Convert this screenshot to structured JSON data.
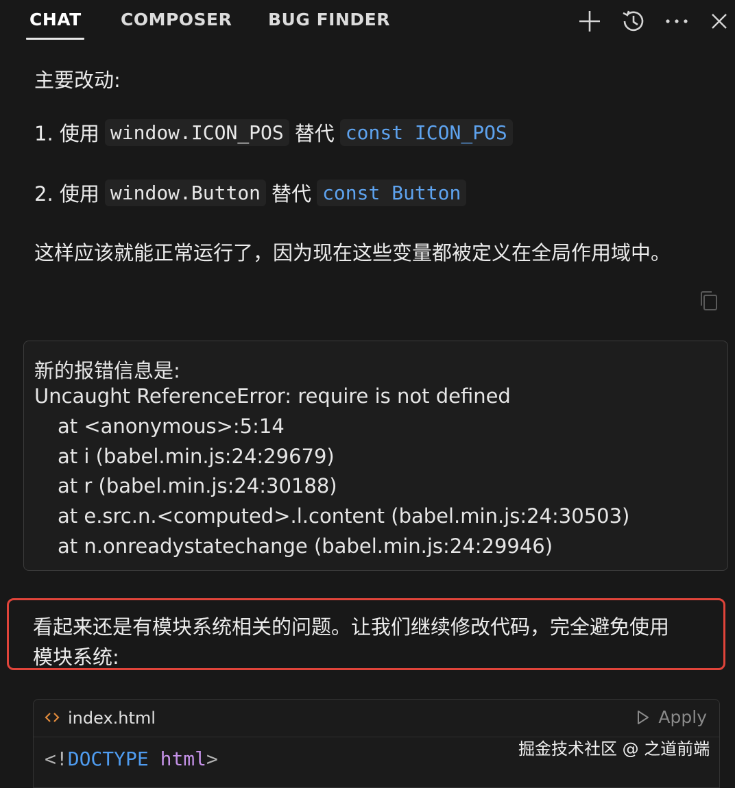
{
  "tabs": [
    {
      "label": "CHAT",
      "active": true
    },
    {
      "label": "COMPOSER",
      "active": false
    },
    {
      "label": "BUG FINDER",
      "active": false
    }
  ],
  "toolbar_icons": [
    "plus-icon",
    "history-icon",
    "more-icon",
    "close-icon"
  ],
  "assistant_message": {
    "heading": "主要改动:",
    "item1": {
      "prefix": "1. 使用",
      "code_a": "window.ICON_POS",
      "mid": "替代",
      "code_b": "const ICON_POS"
    },
    "item2": {
      "prefix": "2. 使用",
      "code_a": "window.Button",
      "mid": "替代",
      "code_b": "const Button"
    },
    "summary": "这样应该就能正常运行了，因为现在这些变量都被定义在全局作用域中。"
  },
  "user_message": {
    "lines": [
      "新的报错信息是:",
      "Uncaught ReferenceError: require is not defined",
      "at <anonymous>:5:14",
      "at i (babel.min.js:24:29679)",
      "at r (babel.min.js:24:30188)",
      "at e.src.n.<computed>.l.content (babel.min.js:24:30503)",
      "at n.onreadystatechange (babel.min.js:24:29946)"
    ]
  },
  "reply": {
    "line1": "看起来还是有模块系统相关的问题。让我们继续修改代码，完全避免使用",
    "line2": "模块系统:"
  },
  "code_block": {
    "filename": "index.html",
    "apply_label": "Apply",
    "first_line": {
      "open": "<!",
      "keyword": "DOCTYPE",
      "attr": "html",
      "close": ">"
    }
  },
  "watermark": "掘金技术社区 @ 之道前端",
  "colors": {
    "background": "#181818",
    "code_blue": "#5ea3ef",
    "highlight_border": "#e0443a",
    "code_keyword": "#4f9cf0",
    "code_attr": "#c592e8"
  }
}
